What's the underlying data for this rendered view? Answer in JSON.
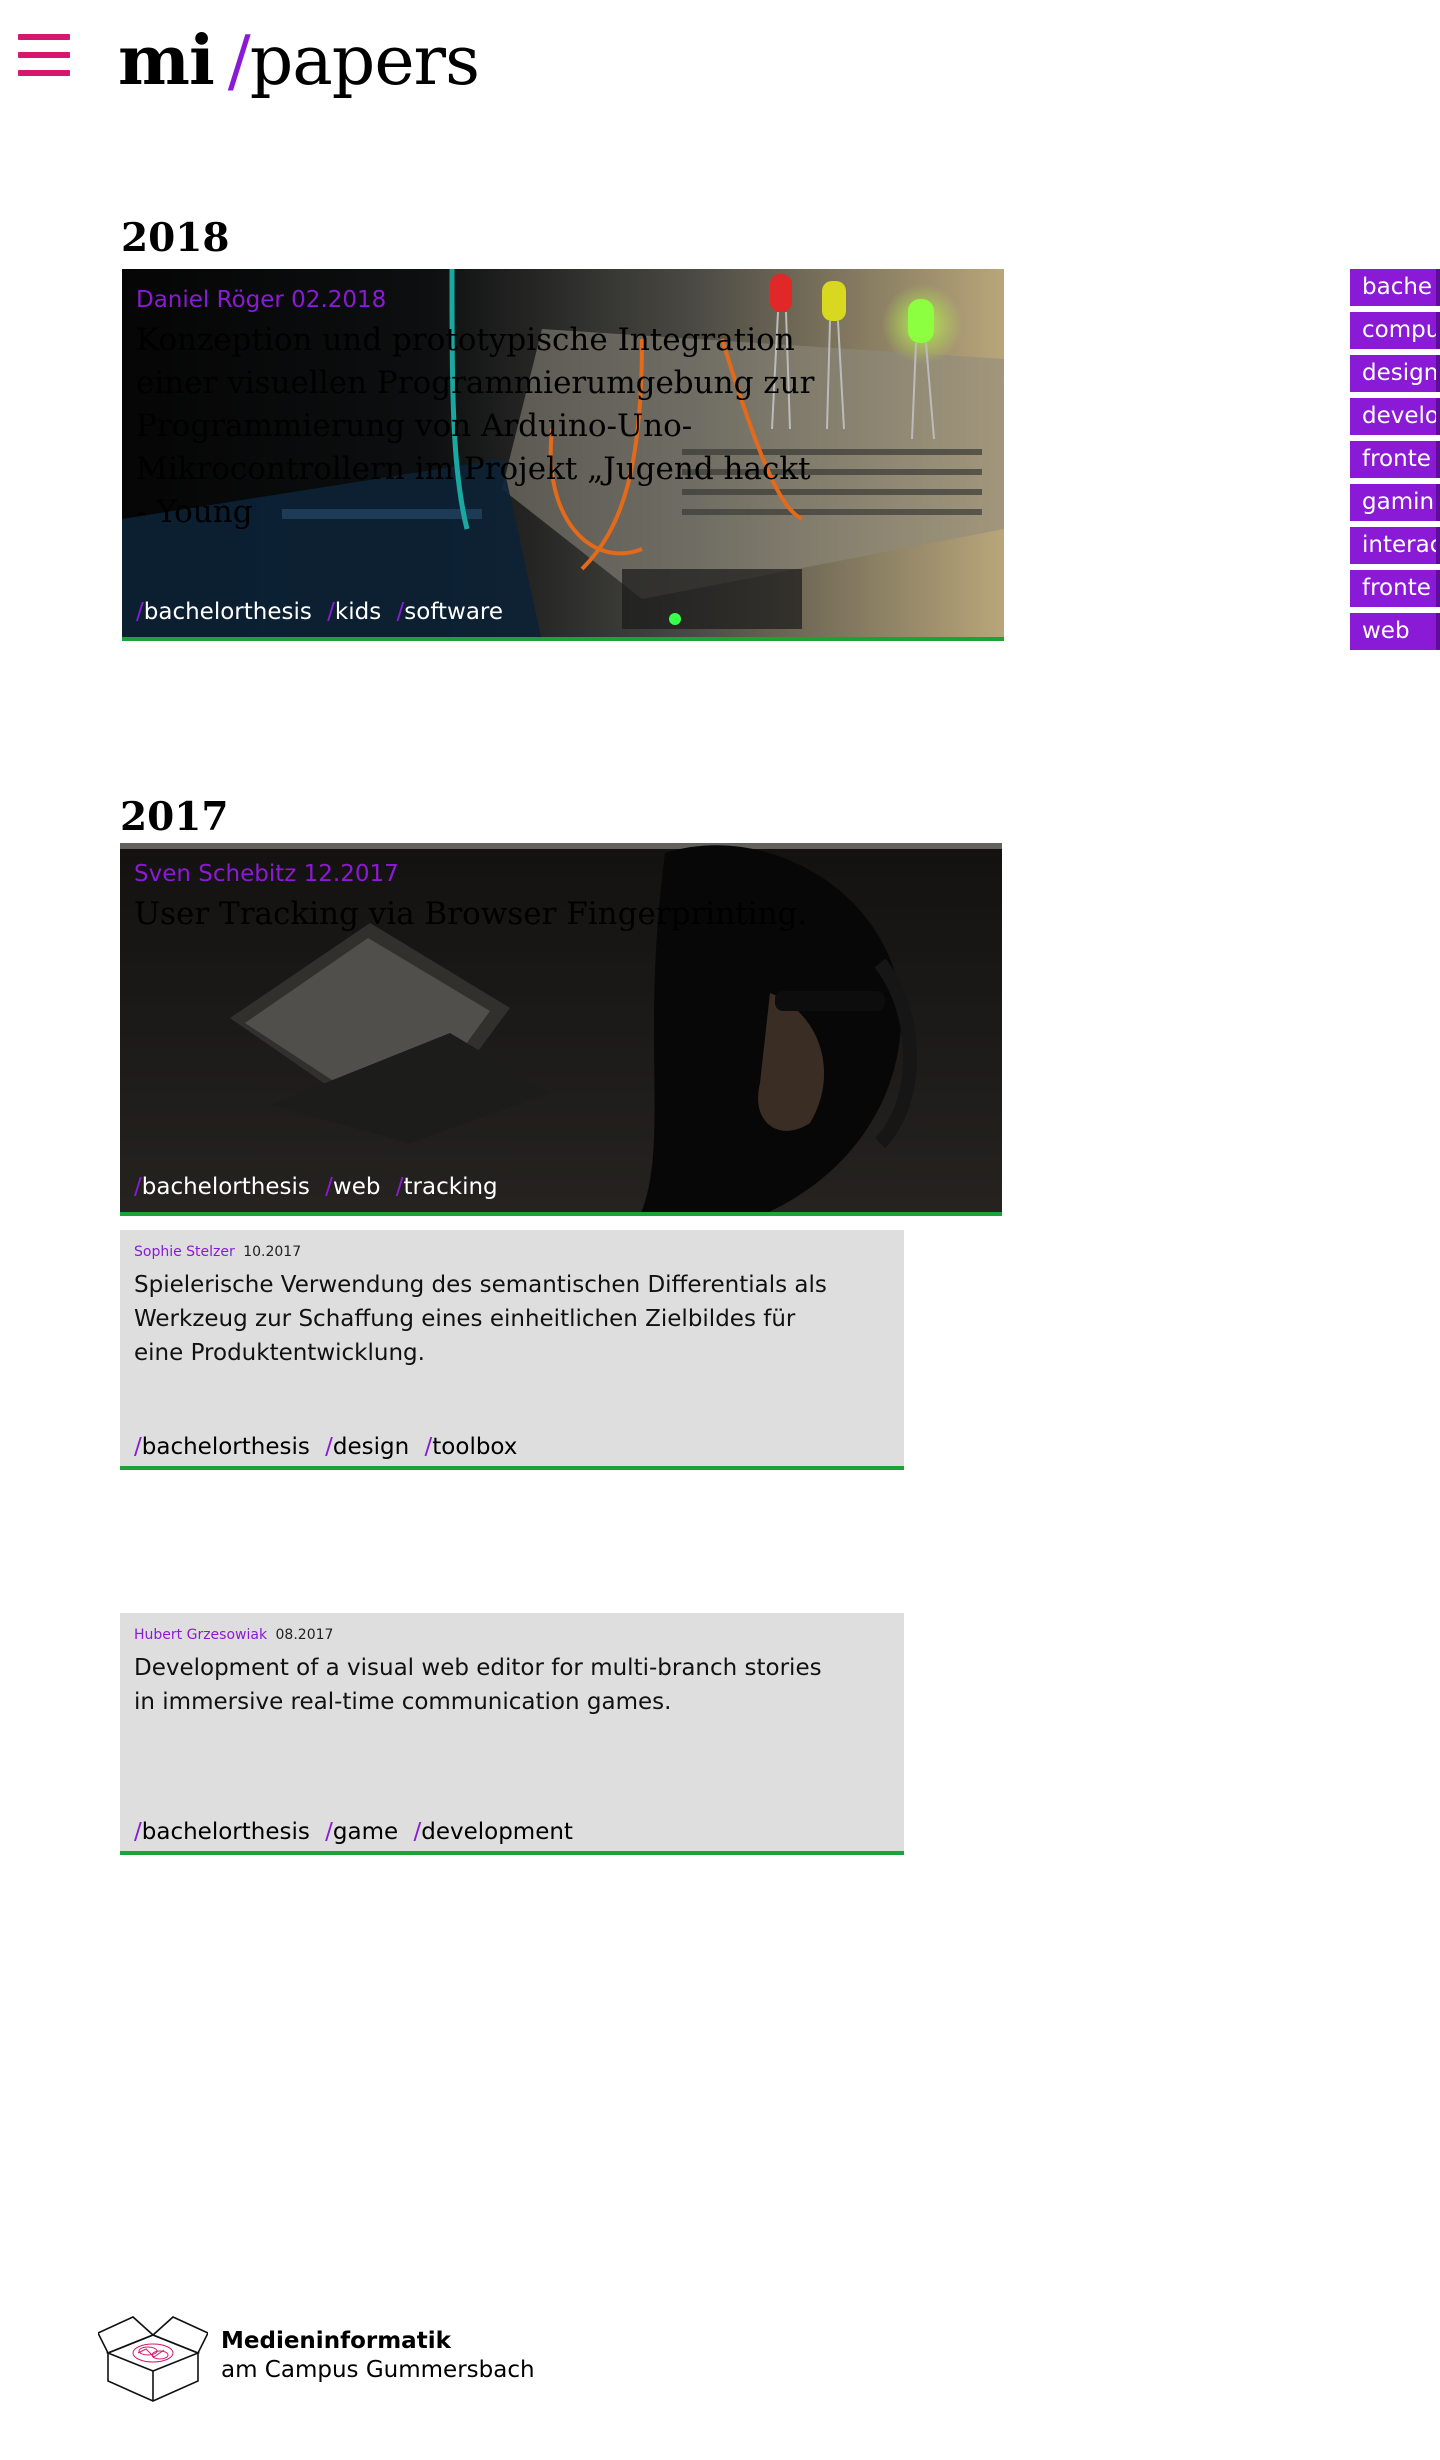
{
  "header": {
    "logo_mi": "mi",
    "logo_slash": "/",
    "logo_papers": "papers"
  },
  "sections": [
    {
      "year": "2018",
      "cards": [
        {
          "style": "image",
          "author": "Daniel Röger",
          "date": "02.2018",
          "title": "Konzeption und prototypische Integration einer visuellen Programmierumgebung zur Programmierung von Arduino-Uno-Mikrocontrollern im Projekt „Jugend hackt - Young",
          "tags": [
            "bachelorthesis",
            "kids",
            "software"
          ]
        }
      ]
    },
    {
      "year": "2017",
      "cards": [
        {
          "style": "image",
          "author": "Sven Schebitz",
          "date": "12.2017",
          "title": "User Tracking via Browser Fingerprinting.",
          "tags": [
            "bachelorthesis",
            "web",
            "tracking"
          ]
        },
        {
          "style": "plain",
          "author": "Sophie Stelzer",
          "date": "10.2017",
          "title": "Spielerische Verwendung des semantischen Differentials als Werkzeug zur Schaffung eines einheitlichen Zielbildes für eine Produktentwicklung.",
          "tags": [
            "bachelorthesis",
            "design",
            "toolbox"
          ]
        },
        {
          "style": "plain",
          "author": "Hubert Grzesowiak",
          "date": "08.2017",
          "title": "Development of a visual web editor for multi-branch stories in immersive real-time communication games.",
          "tags": [
            "bachelorthesis",
            "game",
            "development"
          ]
        }
      ]
    }
  ],
  "tag_sidebar": [
    "bache",
    "compu",
    "design",
    "develo",
    "fronte",
    "gamin",
    "interac",
    "fronte",
    "web"
  ],
  "footer": {
    "line1": "Medieninformatik",
    "line2": "am Campus Gummersbach"
  },
  "colors": {
    "accent_purple": "#8a1ad6",
    "menu_pink": "#d6176d",
    "card_border_green": "#1da23a",
    "card_plain_bg": "#dedede"
  },
  "icons": {
    "menu": "hamburger-menu-icon",
    "footer_logo": "medieninformatik-box-logo"
  }
}
